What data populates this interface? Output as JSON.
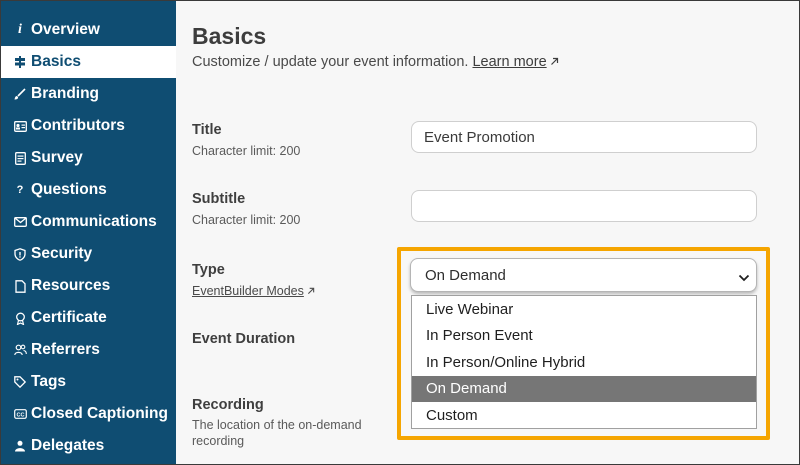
{
  "sidebar": {
    "items": [
      {
        "label": "Overview",
        "icon": "info-icon",
        "active": false
      },
      {
        "label": "Basics",
        "icon": "signpost-icon",
        "active": true
      },
      {
        "label": "Branding",
        "icon": "brush-icon",
        "active": false
      },
      {
        "label": "Contributors",
        "icon": "id-card-icon",
        "active": false
      },
      {
        "label": "Survey",
        "icon": "survey-icon",
        "active": false
      },
      {
        "label": "Questions",
        "icon": "question-icon",
        "active": false
      },
      {
        "label": "Communications",
        "icon": "envelope-icon",
        "active": false
      },
      {
        "label": "Security",
        "icon": "shield-icon",
        "active": false
      },
      {
        "label": "Resources",
        "icon": "document-icon",
        "active": false
      },
      {
        "label": "Certificate",
        "icon": "award-icon",
        "active": false
      },
      {
        "label": "Referrers",
        "icon": "users-icon",
        "active": false
      },
      {
        "label": "Tags",
        "icon": "tag-icon",
        "active": false
      },
      {
        "label": "Closed Captioning",
        "icon": "cc-icon",
        "active": false
      },
      {
        "label": "Delegates",
        "icon": "person-icon",
        "active": false
      }
    ]
  },
  "page": {
    "title": "Basics",
    "subtitle": "Customize / update your event information.",
    "learn_more": "Learn more"
  },
  "form": {
    "title": {
      "label": "Title",
      "hint": "Character limit: 200",
      "value": "Event Promotion"
    },
    "subtitle": {
      "label": "Subtitle",
      "hint": "Character limit: 200",
      "value": ""
    },
    "type": {
      "label": "Type",
      "hint_link": "EventBuilder Modes",
      "selected": "On Demand",
      "options": [
        "Live Webinar",
        "In Person Event",
        "In Person/Online Hybrid",
        "On Demand",
        "Custom"
      ]
    },
    "event_duration": {
      "label": "Event Duration"
    },
    "recording": {
      "label": "Recording",
      "hint": "The location of the on-demand recording"
    }
  },
  "colors": {
    "sidebar_bg": "#0f4d72",
    "highlight": "#f5a500",
    "selected_option_bg": "#767676"
  }
}
